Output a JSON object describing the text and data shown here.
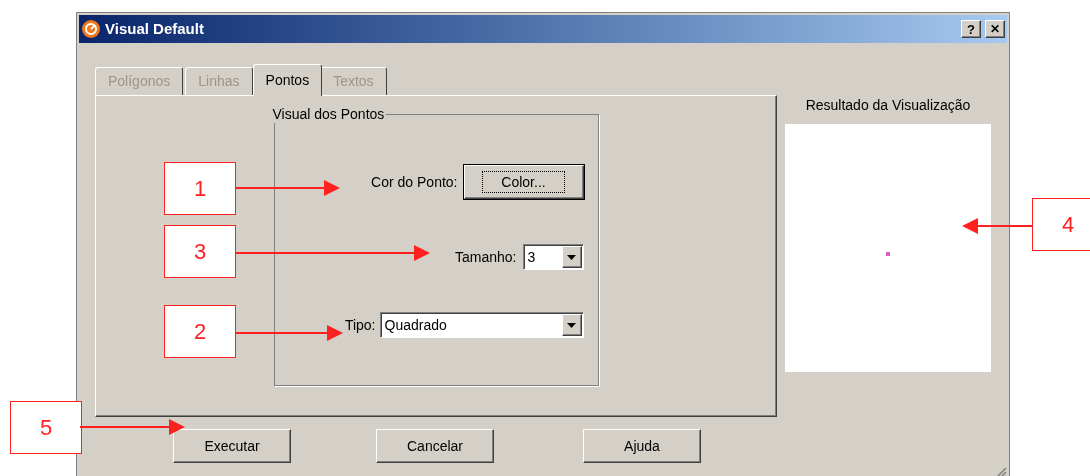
{
  "window": {
    "title": "Visual Default",
    "help_button": "?",
    "close_button": "✕"
  },
  "tabs": [
    {
      "label": "Polígonos",
      "selected": false,
      "disabled": true
    },
    {
      "label": "Linhas",
      "selected": false,
      "disabled": true
    },
    {
      "label": "Pontos",
      "selected": true,
      "disabled": false
    },
    {
      "label": "Textos",
      "selected": false,
      "disabled": true
    }
  ],
  "group": {
    "title": "Visual dos Pontos",
    "color_label": "Cor do Ponto:",
    "color_button": "Color...",
    "size_label": "Tamanho:",
    "size_value": "3",
    "type_label": "Tipo:",
    "type_value": "Quadrado"
  },
  "preview": {
    "title": "Resultado da Visualização"
  },
  "buttons": [
    "Executar",
    "Cancelar",
    "Ajuda"
  ],
  "callouts": [
    "1",
    "3",
    "2",
    "4",
    "5"
  ]
}
